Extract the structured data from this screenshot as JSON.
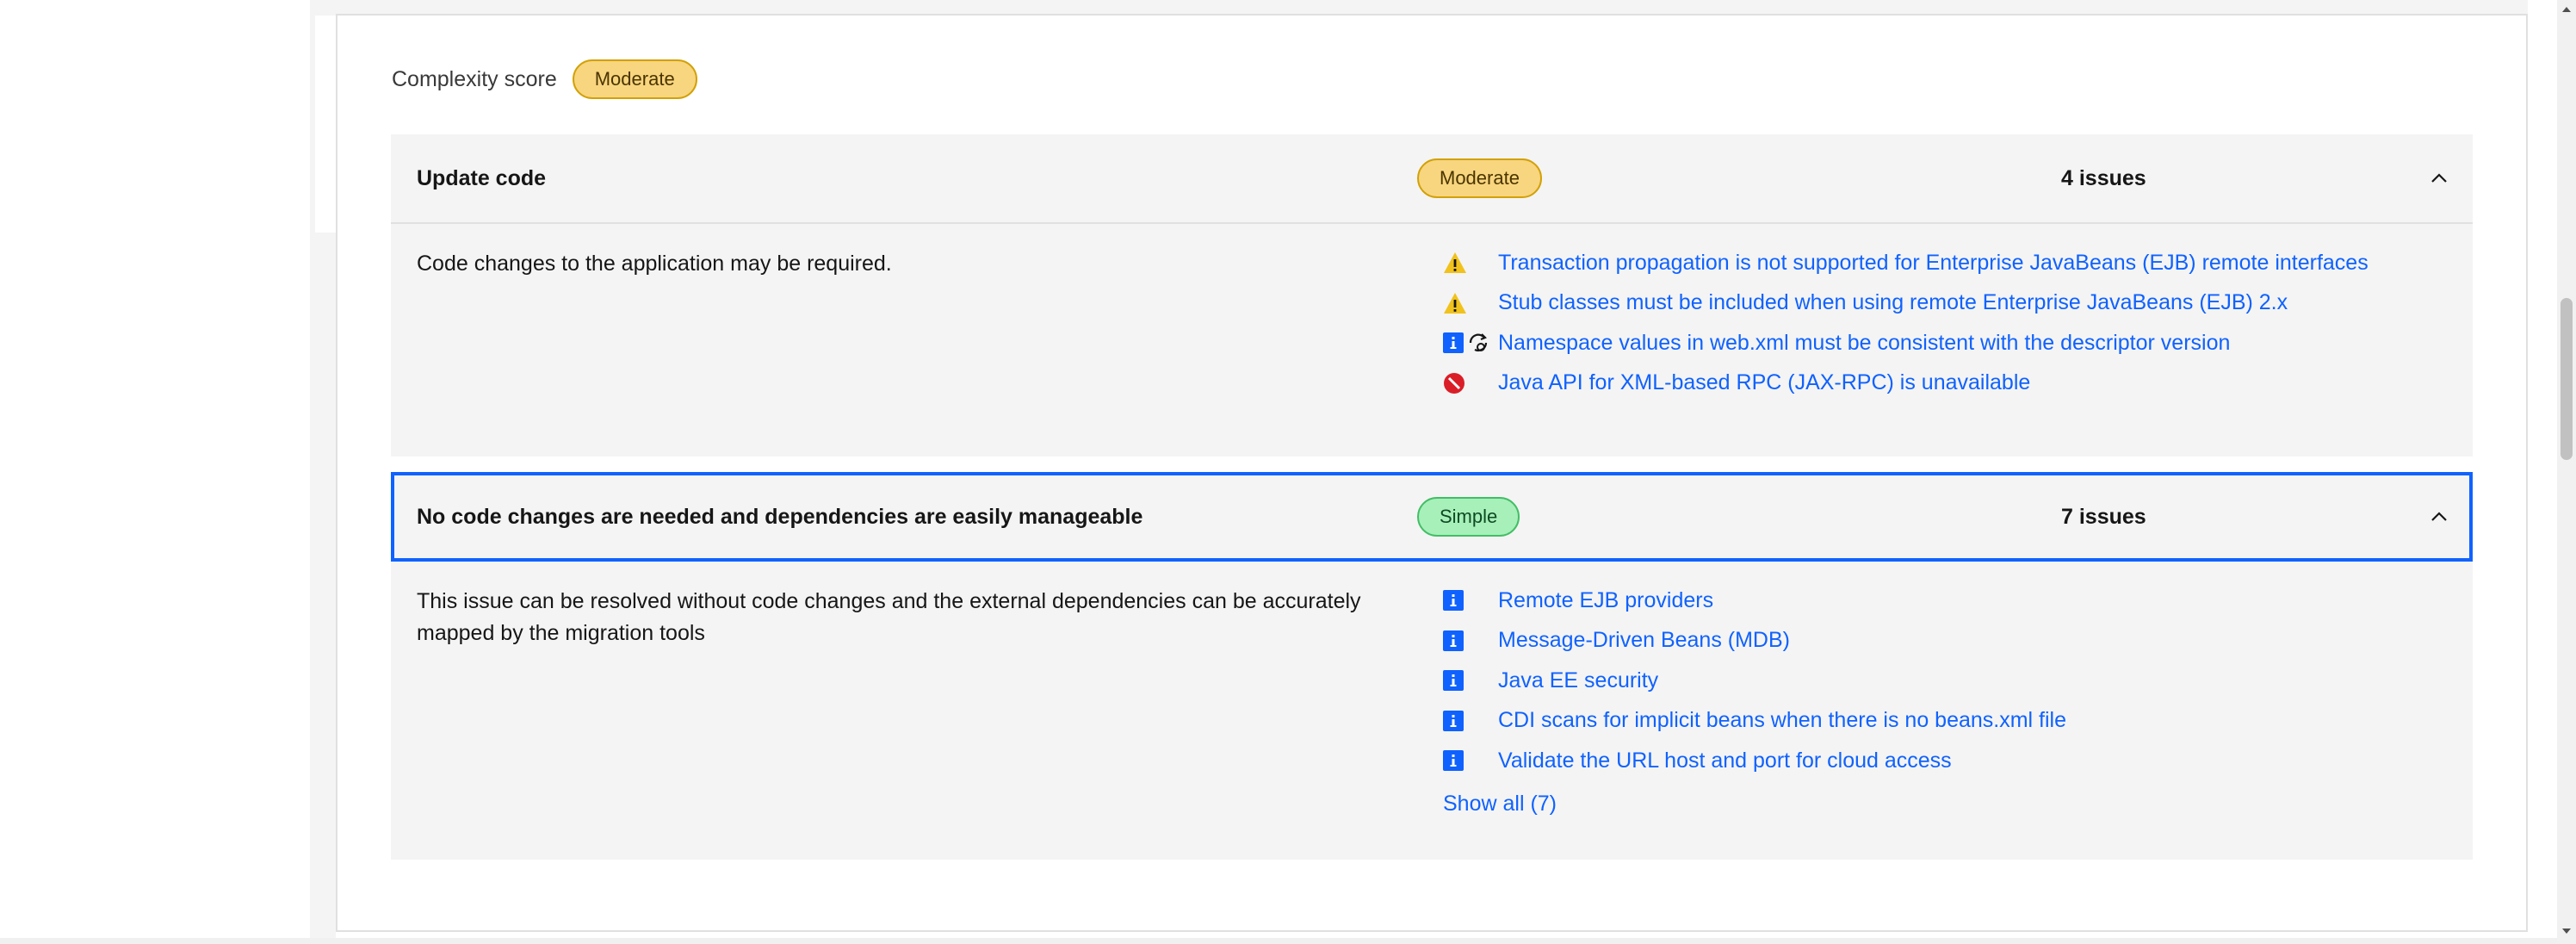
{
  "complexity": {
    "label": "Complexity score",
    "badge": "Moderate"
  },
  "sections": [
    {
      "title": "Update code",
      "badge": "Moderate",
      "count": "4 issues",
      "description": "Code changes to the application may be required.",
      "issues": [
        {
          "icons": [
            "warning-icon"
          ],
          "text": "Transaction propagation is not supported for Enterprise JavaBeans (EJB) remote interfaces"
        },
        {
          "icons": [
            "warning-icon"
          ],
          "text": "Stub classes must be included when using remote Enterprise JavaBeans (EJB) 2.x"
        },
        {
          "icons": [
            "info-icon",
            "automated-fix-icon"
          ],
          "text": "Namespace values in web.xml must be consistent with the descriptor version"
        },
        {
          "icons": [
            "error-icon"
          ],
          "text": "Java API for XML-based RPC (JAX-RPC) is unavailable"
        }
      ]
    },
    {
      "title": "No code changes are needed and dependencies are easily manageable",
      "badge": "Simple",
      "count": "7 issues",
      "description": "This issue can be resolved without code changes and the external dependencies can be accurately mapped by the migration tools",
      "issues": [
        {
          "icons": [
            "info-icon"
          ],
          "text": "Remote EJB providers"
        },
        {
          "icons": [
            "info-icon"
          ],
          "text": "Message-Driven Beans (MDB)"
        },
        {
          "icons": [
            "info-icon"
          ],
          "text": "Java EE security"
        },
        {
          "icons": [
            "info-icon"
          ],
          "text": "CDI scans for implicit beans when there is no beans.xml file"
        },
        {
          "icons": [
            "info-icon"
          ],
          "text": "Validate the URL host and port for cloud access"
        }
      ],
      "show_all": "Show all (7)"
    }
  ],
  "colors": {
    "link": "#0f62fe",
    "moderate": "#f8d57f",
    "simple": "#a7f0ba",
    "warning": "#f1c21b",
    "error": "#da1e28",
    "info": "#0f62fe"
  }
}
